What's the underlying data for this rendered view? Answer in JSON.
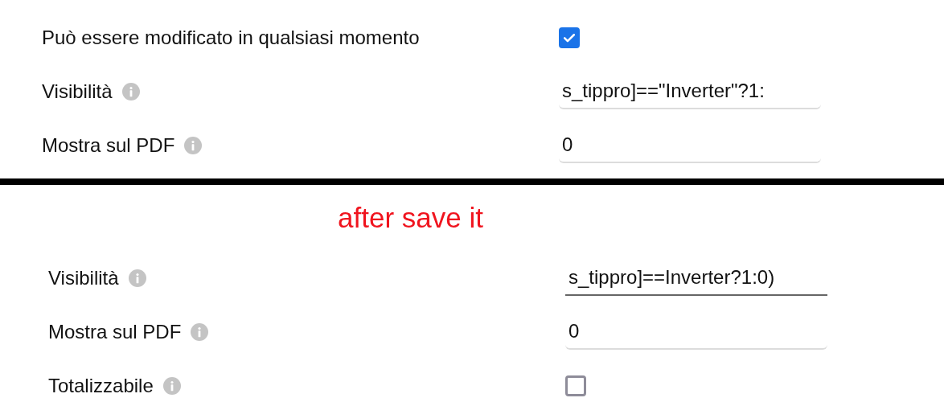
{
  "before": {
    "rows": [
      {
        "kind": "checkbox",
        "label": "Può essere modificato in qualsiasi momento",
        "info": false,
        "checked": true
      },
      {
        "kind": "field",
        "label": "Visibilità",
        "info": true,
        "value": "s_tippro]==\"Inverter\"?1:",
        "focused": false
      },
      {
        "kind": "field",
        "label": "Mostra sul PDF",
        "info": true,
        "value": "0",
        "focused": false
      }
    ]
  },
  "caption": "after save it",
  "after": {
    "rows": [
      {
        "kind": "field",
        "label": "Visibilità",
        "info": true,
        "value": "s_tippro]==Inverter?1:0)",
        "focused": true
      },
      {
        "kind": "field",
        "label": "Mostra sul PDF",
        "info": true,
        "value": "0",
        "focused": false
      },
      {
        "kind": "checkbox",
        "label": "Totalizzabile",
        "info": true,
        "checked": false
      }
    ]
  }
}
